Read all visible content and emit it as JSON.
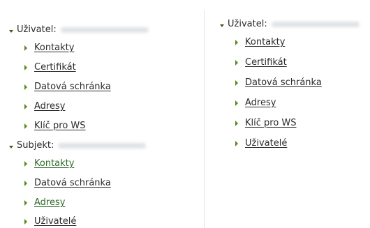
{
  "left": {
    "groups": [
      {
        "label": "Uživatel:",
        "items": [
          {
            "label": "Kontakty",
            "color": "#2b2b2b"
          },
          {
            "label": "Certifikát",
            "color": "#2b2b2b"
          },
          {
            "label": "Datová schránka",
            "color": "#2b2b2b"
          },
          {
            "label": "Adresy",
            "color": "#2b2b2b"
          },
          {
            "label": "Klíč pro WS",
            "color": "#2b2b2b"
          }
        ]
      },
      {
        "label": "Subjekt:",
        "items": [
          {
            "label": "Kontakty",
            "color": "#2f6b2a"
          },
          {
            "label": "Datová schránka",
            "color": "#2b2b2b"
          },
          {
            "label": "Adresy",
            "color": "#2f6b2a"
          },
          {
            "label": "Uživatelé",
            "color": "#2b2b2b"
          }
        ]
      }
    ]
  },
  "right": {
    "group": {
      "label": "Uživatel:",
      "items": [
        {
          "label": "Kontakty"
        },
        {
          "label": "Certifikát"
        },
        {
          "label": "Datová schránka"
        },
        {
          "label": "Adresy"
        },
        {
          "label": "Klíč pro WS"
        },
        {
          "label": "Uživatelé"
        }
      ]
    }
  }
}
